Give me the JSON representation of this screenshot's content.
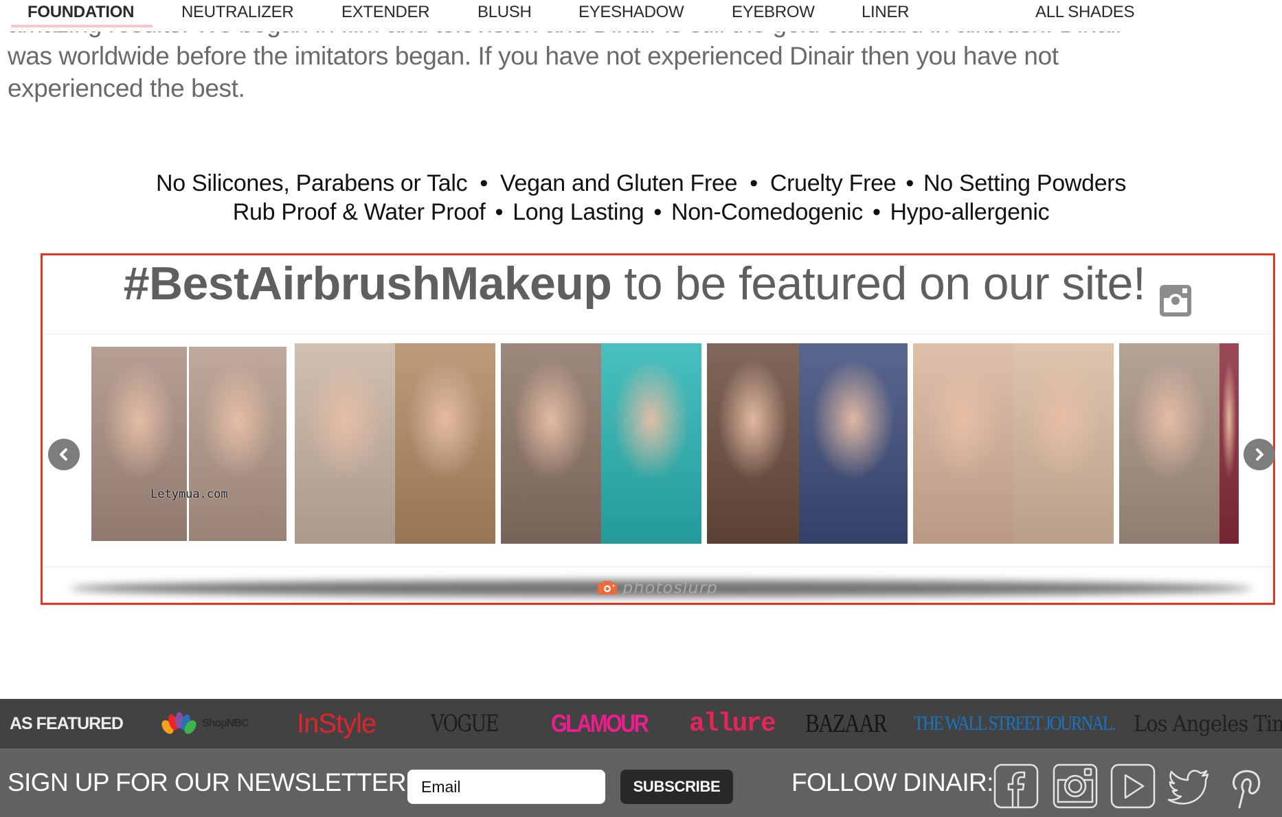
{
  "nav": {
    "tabs": [
      {
        "label": "FOUNDATION",
        "active": true
      },
      {
        "label": "NEUTRALIZER",
        "active": false
      },
      {
        "label": "EXTENDER",
        "active": false
      },
      {
        "label": "BLUSH",
        "active": false
      },
      {
        "label": "EYESHADOW",
        "active": false
      },
      {
        "label": "EYEBROW",
        "active": false
      },
      {
        "label": "LINER",
        "active": false
      },
      {
        "label": "ALL SHADES",
        "active": false
      }
    ],
    "active_underline_color": "#f6c7c9"
  },
  "intro": {
    "cut_line": "amazing results. We began in film and television and Dinair is still the gold standard in airbrush. Dinair",
    "line2": "was worldwide before the imitators began. If you have not experienced Dinair then you have not",
    "line3": "experienced the best."
  },
  "features": {
    "line1": [
      "No Silicones, Parabens or Talc",
      "Vegan and Gluten Free",
      "Cruelty Free",
      "No Setting Powders"
    ],
    "line2": [
      "Rub Proof & Water Proof",
      "Long Lasting",
      "Non-Comedogenic",
      "Hypo-allergenic"
    ],
    "separator": "•"
  },
  "widget": {
    "highlight_color": "#ef3219",
    "hashtag": "#BestAirbrushMakeup",
    "title_rest": " to be featured on our site!",
    "title_icon": "instagram-icon",
    "prev_icon": "chevron-left-icon",
    "next_icon": "chevron-right-icon",
    "slides": [
      {
        "desc": "before-after makeup photo 1",
        "watermark": "Letymua.com",
        "before_color": "#a98f82",
        "after_color": "#b39a8a"
      },
      {
        "desc": "before-after bridal makeup photo 2",
        "watermark": "",
        "before_color": "#c9b4a3",
        "after_color": "#b08a64"
      },
      {
        "desc": "before-after makeup photo 3",
        "watermark": "",
        "before_color": "#8c7466",
        "after_color": "#2bb5b3"
      },
      {
        "desc": "before-after makeup photo 4",
        "watermark": "",
        "before_color": "#6b4d3e",
        "after_color": "#3d4c7a"
      },
      {
        "desc": "before-after makeup photo 5",
        "watermark": "",
        "before_color": "#d8b59c",
        "after_color": "#d9bb9f"
      },
      {
        "desc": "before-after makeup photo 6",
        "watermark": "",
        "before_color": "#a89385",
        "after_color": "#8a2a3a"
      }
    ],
    "powered_by": "photoslurp",
    "powered_icon": "camera-icon",
    "powered_icon_color": "#ee6a3c"
  },
  "featured": {
    "label": "AS FEATURED",
    "logos": [
      {
        "name": "ShopNBC",
        "text": "ShopNBC"
      },
      {
        "name": "InStyle",
        "text": "InStyle"
      },
      {
        "name": "Vogue",
        "text": "VOGUE"
      },
      {
        "name": "Glamour",
        "text": "GLAMOUR"
      },
      {
        "name": "allure",
        "text": "allure"
      },
      {
        "name": "Bazaar",
        "text": "BAZAAR"
      },
      {
        "name": "The Wall Street Journal",
        "text": "THE WALL STREET JOURNAL."
      },
      {
        "name": "Los Angeles Times",
        "text": "Los Angeles Times"
      }
    ]
  },
  "newsletter": {
    "title": "SIGN UP FOR OUR NEWSLETTER",
    "email_placeholder": "Email",
    "email_value": "",
    "subscribe_label": "SUBSCRIBE",
    "follow_label": "FOLLOW DINAIR:",
    "social": [
      "facebook-icon",
      "instagram-icon",
      "youtube-icon",
      "twitter-icon",
      "pinterest-icon"
    ]
  }
}
